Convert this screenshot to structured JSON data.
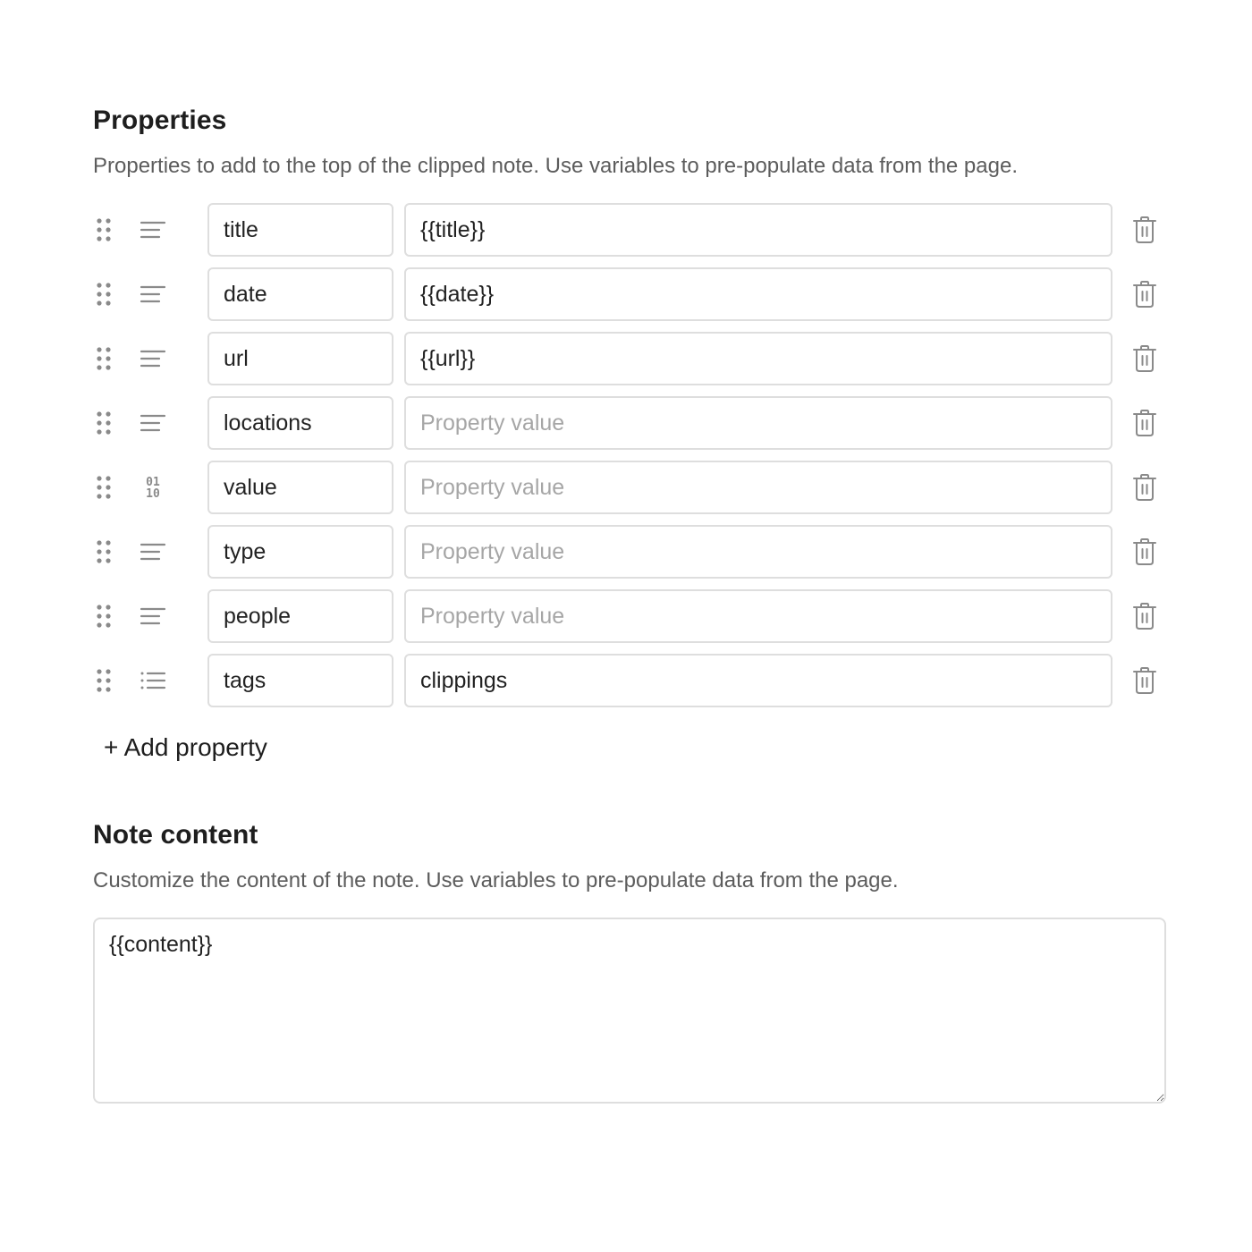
{
  "properties_section": {
    "title": "Properties",
    "description": "Properties to add to the top of the clipped note. Use variables to pre-populate data from the page."
  },
  "properties": [
    {
      "name": "title",
      "value": "{{title}}",
      "placeholder": "Property value",
      "type_icon": "text-lines-icon"
    },
    {
      "name": "date",
      "value": "{{date}}",
      "placeholder": "Property value",
      "type_icon": "text-lines-icon"
    },
    {
      "name": "url",
      "value": "{{url}}",
      "placeholder": "Property value",
      "type_icon": "text-lines-icon"
    },
    {
      "name": "locations",
      "value": "",
      "placeholder": "Property value",
      "type_icon": "text-lines-icon"
    },
    {
      "name": "value",
      "value": "",
      "placeholder": "Property value",
      "type_icon": "number-binary-icon"
    },
    {
      "name": "type",
      "value": "",
      "placeholder": "Property value",
      "type_icon": "text-lines-icon"
    },
    {
      "name": "people",
      "value": "",
      "placeholder": "Property value",
      "type_icon": "text-lines-icon"
    },
    {
      "name": "tags",
      "value": "clippings",
      "placeholder": "Property value",
      "type_icon": "list-icon"
    }
  ],
  "add_property_label": "+ Add property",
  "note_section": {
    "title": "Note content",
    "description": "Customize the content of the note. Use variables to pre-populate data from the page.",
    "content_value": "{{content}}"
  },
  "icons": {
    "drag": "drag-handle-icon",
    "delete": "trash-icon",
    "number_glyph_top": "01",
    "number_glyph_bottom": "10"
  },
  "colors": {
    "icon_gray": "#8a8a8a",
    "border": "#dedede",
    "placeholder": "#a6a6a6",
    "text": "#222222",
    "muted_text": "#5c5c5c"
  }
}
